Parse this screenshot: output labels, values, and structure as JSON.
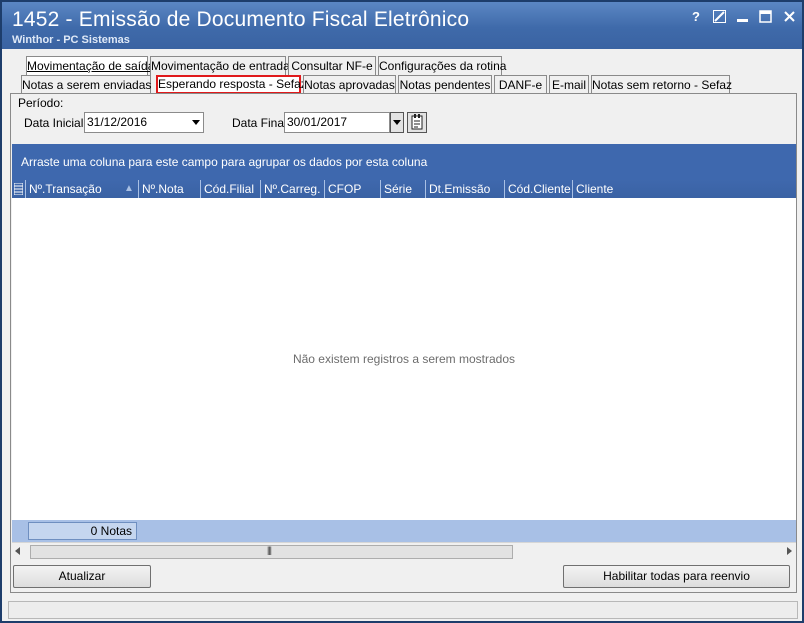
{
  "window": {
    "title": "1452 - Emissão de Documento Fiscal Eletrônico",
    "subtitle": "Winthor - PC Sistemas",
    "controls": [
      "help-icon",
      "edit-icon",
      "minimize-icon",
      "maximize-icon",
      "close-icon"
    ]
  },
  "main_tabs": [
    {
      "label": "Movimentação de saída",
      "active": true
    },
    {
      "label": "Movimentação de entrada"
    },
    {
      "label": "Consultar NF-e"
    },
    {
      "label": "Configurações da rotina"
    }
  ],
  "sub_tabs": [
    {
      "label": "Notas a serem enviadas"
    },
    {
      "label": "Esperando resposta - Sefaz",
      "active": true
    },
    {
      "label": "Notas aprovadas"
    },
    {
      "label": "Notas pendentes"
    },
    {
      "label": "DANF-e"
    },
    {
      "label": "E-mail"
    },
    {
      "label": "Notas sem retorno - Sefaz"
    }
  ],
  "period": {
    "group_label": "Período:",
    "start_label": "Data Inicial",
    "start_value": "31/12/2016",
    "end_label": "Data Final",
    "end_value": "30/01/2017"
  },
  "grid": {
    "group_hint": "Arraste uma coluna para este campo para agrupar os dados por esta coluna",
    "columns": [
      "Nº.Transação",
      "Nº.Nota",
      "Cód.Filial",
      "Nº.Carreg.",
      "CFOP",
      "Série",
      "Dt.Emissão",
      "Cód.Cliente",
      "Cliente"
    ],
    "empty_message": "Não existem registros a serem mostrados",
    "summary": "0 Notas"
  },
  "buttons": {
    "refresh": "Atualizar",
    "enable_resend": "Habilitar todas para reenvio"
  },
  "colors": {
    "titlebar": "#4a77b8",
    "grid_header": "#3e68ae",
    "highlight_border": "#e0191b"
  }
}
